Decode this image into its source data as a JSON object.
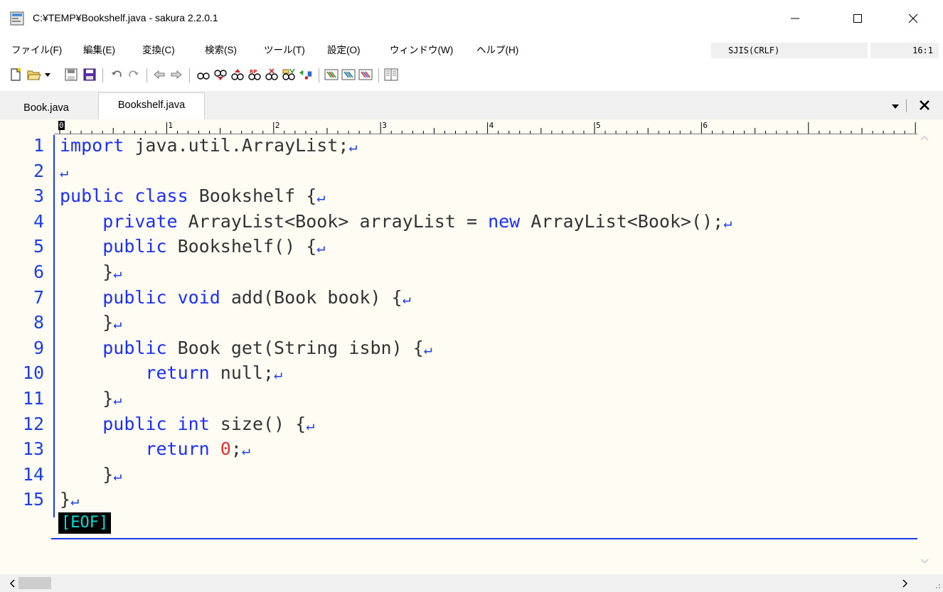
{
  "window": {
    "title": "C:¥TEMP¥Bookshelf.java - sakura 2.2.0.1",
    "controls": {
      "minimize": "minimize-icon",
      "maximize": "maximize-icon",
      "close": "close-icon"
    }
  },
  "menu": {
    "items": [
      "ファイル(F)",
      "編集(E)",
      "変換(C)",
      "検索(S)",
      "ツール(T)",
      "設定(O)",
      "ウィンドウ(W)",
      "ヘルプ(H)"
    ],
    "encoding": "SJIS(CRLF)",
    "cursor_pos": "16:1"
  },
  "toolbar": {
    "icons": [
      "new-file-icon",
      "open-file-icon",
      "dropdown-arrow-icon",
      "save-icon",
      "save-all-icon",
      "undo-icon",
      "redo-icon",
      "move-back-icon",
      "move-forward-icon",
      "search-icon",
      "search-down-icon",
      "search-up-icon",
      "replace-icon",
      "search-clear-icon",
      "grep-icon",
      "jump-icon",
      "tool-config-icon",
      "tool-settings-icon",
      "tool-font-icon",
      "split-view-icon"
    ]
  },
  "tabs": {
    "items": [
      "Book.java",
      "Bookshelf.java"
    ],
    "active_index": 1
  },
  "ruler": {
    "marks": [
      "0",
      "1",
      "2",
      "3",
      "4",
      "5",
      "6"
    ]
  },
  "editor": {
    "line_numbers": [
      "1",
      "2",
      "3",
      "4",
      "5",
      "6",
      "7",
      "8",
      "9",
      "10",
      "11",
      "12",
      "13",
      "14",
      "15"
    ],
    "lines": [
      [
        {
          "t": "import",
          "k": "kw"
        },
        {
          "t": " java.util.ArrayList;",
          "k": ""
        }
      ],
      [],
      [
        {
          "t": "public",
          "k": "kw"
        },
        {
          "t": " ",
          "k": ""
        },
        {
          "t": "class",
          "k": "kw"
        },
        {
          "t": " Bookshelf {",
          "k": ""
        }
      ],
      [
        {
          "t": "    ",
          "k": ""
        },
        {
          "t": "private",
          "k": "kw"
        },
        {
          "t": " ArrayList<Book> arrayList = ",
          "k": ""
        },
        {
          "t": "new",
          "k": "kw"
        },
        {
          "t": " ArrayList<Book>();",
          "k": ""
        }
      ],
      [
        {
          "t": "    ",
          "k": ""
        },
        {
          "t": "public",
          "k": "kw"
        },
        {
          "t": " Bookshelf() {",
          "k": ""
        }
      ],
      [
        {
          "t": "    }",
          "k": ""
        }
      ],
      [
        {
          "t": "    ",
          "k": ""
        },
        {
          "t": "public",
          "k": "kw"
        },
        {
          "t": " ",
          "k": ""
        },
        {
          "t": "void",
          "k": "kw"
        },
        {
          "t": " add(Book book) {",
          "k": ""
        }
      ],
      [
        {
          "t": "    }",
          "k": ""
        }
      ],
      [
        {
          "t": "    ",
          "k": ""
        },
        {
          "t": "public",
          "k": "kw"
        },
        {
          "t": " Book get(String isbn) {",
          "k": ""
        }
      ],
      [
        {
          "t": "        ",
          "k": ""
        },
        {
          "t": "return",
          "k": "kw"
        },
        {
          "t": " null;",
          "k": ""
        }
      ],
      [
        {
          "t": "    }",
          "k": ""
        }
      ],
      [
        {
          "t": "    ",
          "k": ""
        },
        {
          "t": "public",
          "k": "kw"
        },
        {
          "t": " ",
          "k": ""
        },
        {
          "t": "int",
          "k": "kw"
        },
        {
          "t": " size() {",
          "k": ""
        }
      ],
      [
        {
          "t": "        ",
          "k": ""
        },
        {
          "t": "return",
          "k": "kw"
        },
        {
          "t": " ",
          "k": ""
        },
        {
          "t": "0",
          "k": "num"
        },
        {
          "t": ";",
          "k": ""
        }
      ],
      [
        {
          "t": "    }",
          "k": ""
        }
      ],
      [
        {
          "t": "}",
          "k": ""
        }
      ]
    ],
    "crlf_glyph": "↵",
    "eof_label": "[EOF]"
  },
  "colors": {
    "keyword": "#1a2eff",
    "text": "#333333",
    "number": "#e62e2e",
    "line_number": "#1a3ee8",
    "editor_bg": "#fffdf3"
  }
}
